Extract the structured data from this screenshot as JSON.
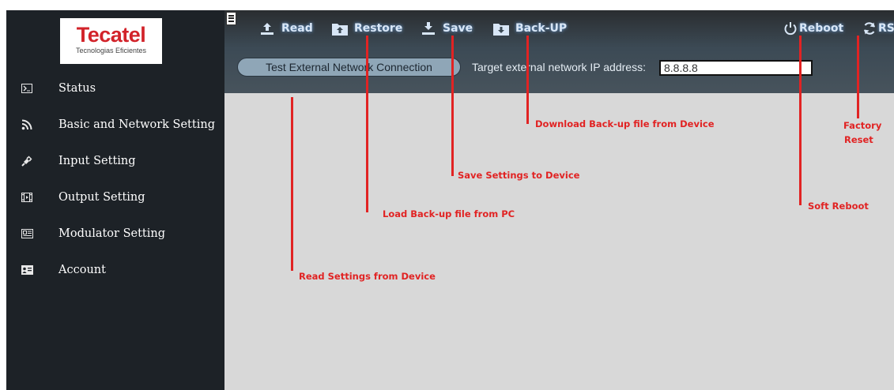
{
  "sidebar": {
    "logo": {
      "brand": "Tecatel",
      "tagline": "Tecnologias Eficientes"
    },
    "items": [
      {
        "label": "Status",
        "icon": "terminal-icon"
      },
      {
        "label": "Basic and Network Setting",
        "icon": "rss-icon"
      },
      {
        "label": "Input Setting",
        "icon": "plug-icon"
      },
      {
        "label": "Output Setting",
        "icon": "film-icon"
      },
      {
        "label": "Modulator Setting",
        "icon": "newspaper-icon"
      },
      {
        "label": "Account",
        "icon": "id-card-icon"
      }
    ]
  },
  "toolbar": {
    "read_label": "Read",
    "restore_label": "Restore",
    "save_label": "Save",
    "backup_label": "Back-UP",
    "reboot_label": "Reboot",
    "rst_label": "RST"
  },
  "network_test": {
    "button_label": "Test External Network Connection",
    "ip_label": "Target external network IP address:",
    "ip_value": "8.8.8.8"
  },
  "annotations": {
    "read": "Read Settings from Device",
    "restore": "Load Back-up file from PC",
    "save": "Save Settings to Device",
    "backup": "Download Back-up file from Device",
    "reboot": "Soft Reboot",
    "rst_line1": "Factory",
    "rst_line2": "Reset"
  },
  "colors": {
    "sidebar_bg": "#1d2227",
    "content_bg": "#d8d8d8",
    "brand_red": "#d2232a",
    "annotation_red": "#e12323",
    "toolbar_text": "#d8e6f6"
  }
}
